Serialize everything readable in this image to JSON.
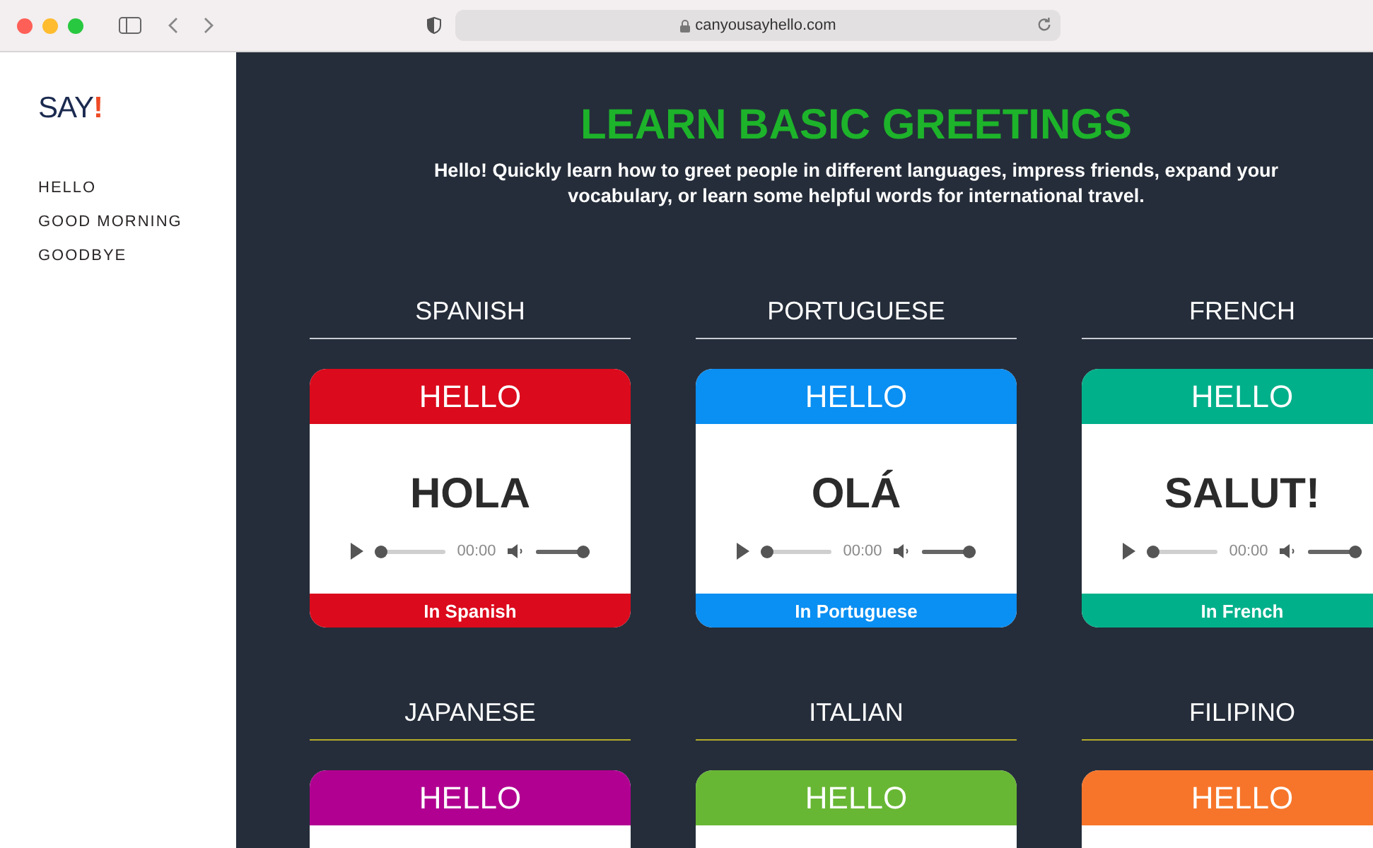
{
  "browser": {
    "url": "canyousayhello.com"
  },
  "sidebar": {
    "logo": {
      "text": "SAY",
      "accent": "!"
    },
    "items": [
      {
        "label": "HELLO"
      },
      {
        "label": "GOOD MORNING"
      },
      {
        "label": "GOODBYE"
      }
    ]
  },
  "hero": {
    "title": "LEARN BASIC GREETINGS",
    "subtitle": "Hello! Quickly learn how to greet people in different languages, impress friends, expand your vocabulary, or learn some helpful words for international travel."
  },
  "languages": [
    {
      "name": "SPANISH",
      "divider": {
        "color": "#c9ccd2"
      },
      "color": "#db0a1c",
      "header": "HELLO",
      "word": "HOLA",
      "player": {
        "time": "00:00",
        "progress": {
          "level": 0
        },
        "volume": {
          "level": 1
        }
      },
      "footer": "In Spanish"
    },
    {
      "name": "PORTUGUESE",
      "divider": {
        "color": "#c9ccd2"
      },
      "color": "#0a8ff2",
      "header": "HELLO",
      "word": "OLÁ",
      "player": {
        "time": "00:00",
        "progress": {
          "level": 0
        },
        "volume": {
          "level": 1
        }
      },
      "footer": "In Portuguese"
    },
    {
      "name": "FRENCH",
      "divider": {
        "color": "#c9ccd2"
      },
      "color": "#00b08a",
      "header": "HELLO",
      "word": "SALUT!",
      "player": {
        "time": "00:00",
        "progress": {
          "level": 0
        },
        "volume": {
          "level": 1
        }
      },
      "footer": "In French"
    },
    {
      "name": "JAPANESE",
      "divider": {
        "color": "#b3ac2a"
      },
      "color": "#b10091",
      "header": "HELLO"
    },
    {
      "name": "ITALIAN",
      "divider": {
        "color": "#b3ac2a"
      },
      "color": "#68b734",
      "header": "HELLO"
    },
    {
      "name": "FILIPINO",
      "divider": {
        "color": "#b3ac2a"
      },
      "color": "#f7752a",
      "header": "HELLO"
    }
  ]
}
